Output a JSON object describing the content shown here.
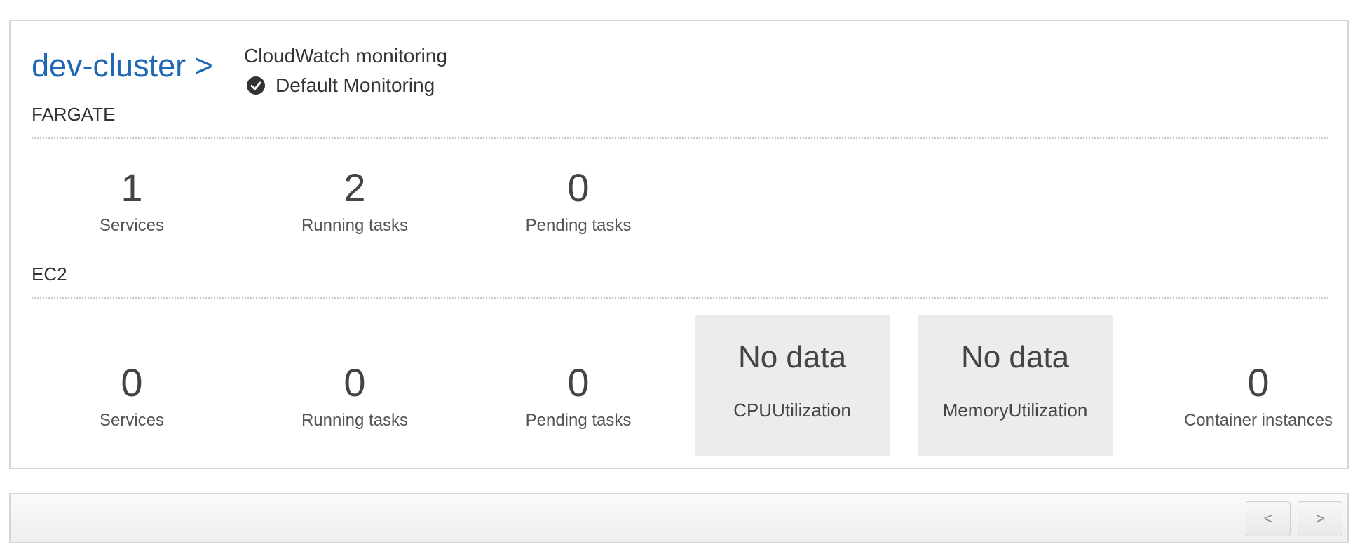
{
  "cluster": {
    "name_link": "dev-cluster >"
  },
  "cloudwatch": {
    "title": "CloudWatch monitoring",
    "status": "Default Monitoring",
    "status_icon": "check-circle-icon"
  },
  "fargate": {
    "label": "FARGATE",
    "metrics": [
      {
        "value": "1",
        "label": "Services"
      },
      {
        "value": "2",
        "label": "Running tasks"
      },
      {
        "value": "0",
        "label": "Pending tasks"
      }
    ]
  },
  "ec2": {
    "label": "EC2",
    "metrics": [
      {
        "value": "0",
        "label": "Services"
      },
      {
        "value": "0",
        "label": "Running tasks"
      },
      {
        "value": "0",
        "label": "Pending tasks"
      }
    ],
    "utilization": [
      {
        "value": "No data",
        "label": "CPUUtilization"
      },
      {
        "value": "No data",
        "label": "MemoryUtilization"
      }
    ],
    "container_instances": {
      "value": "0",
      "label": "Container instances"
    }
  },
  "pager": {
    "prev_label": "<",
    "next_label": ">"
  },
  "colors": {
    "link": "#1f68b5",
    "nodata_bg": "#ececec",
    "border": "#d5d5d5"
  }
}
